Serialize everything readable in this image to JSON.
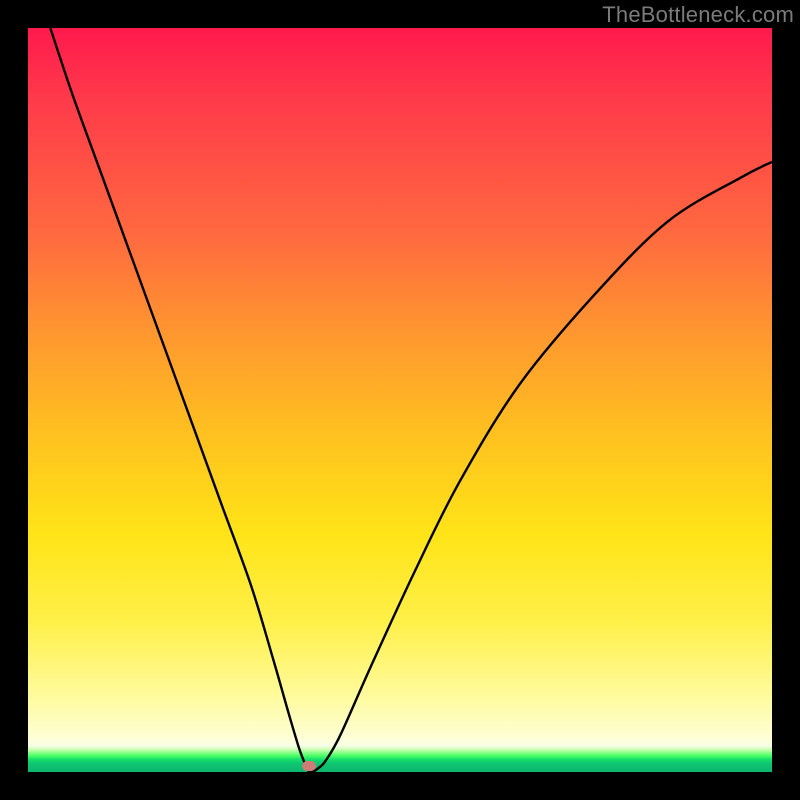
{
  "watermark": {
    "text": "TheBottleneck.com"
  },
  "colors": {
    "background_black": "#000000",
    "gradient_top": "#ff1a4d",
    "gradient_mid1": "#ff9a2e",
    "gradient_mid2": "#ffe417",
    "gradient_pale": "#fdffd6",
    "gradient_green": "#17e06a",
    "curve": "#000000",
    "marker": "#cf7c76",
    "watermark": "#7b7b7b"
  },
  "chart_data": {
    "type": "line",
    "title": "",
    "xlabel": "",
    "ylabel": "",
    "xlim": [
      0,
      100
    ],
    "ylim": [
      0,
      100
    ],
    "series": [
      {
        "name": "bottleneck-curve",
        "x": [
          3,
          6,
          10,
          14,
          18,
          22,
          26,
          30,
          33,
          35,
          36.5,
          37.5,
          37.8,
          38.2,
          39,
          40,
          42,
          46,
          52,
          58,
          66,
          76,
          86,
          96,
          100
        ],
        "y": [
          100,
          91,
          80,
          69,
          58,
          47,
          36,
          25,
          15,
          8,
          3,
          0.5,
          0,
          0,
          0.5,
          1.5,
          5,
          14,
          27,
          39,
          52,
          64,
          74,
          80,
          82
        ]
      }
    ],
    "marker": {
      "x": 37.8,
      "y": 0.8,
      "label": "optimal-point"
    },
    "annotations": [
      {
        "text": "TheBottleneck.com",
        "role": "watermark",
        "position": "top-right"
      }
    ],
    "grid": false,
    "legend": false
  }
}
